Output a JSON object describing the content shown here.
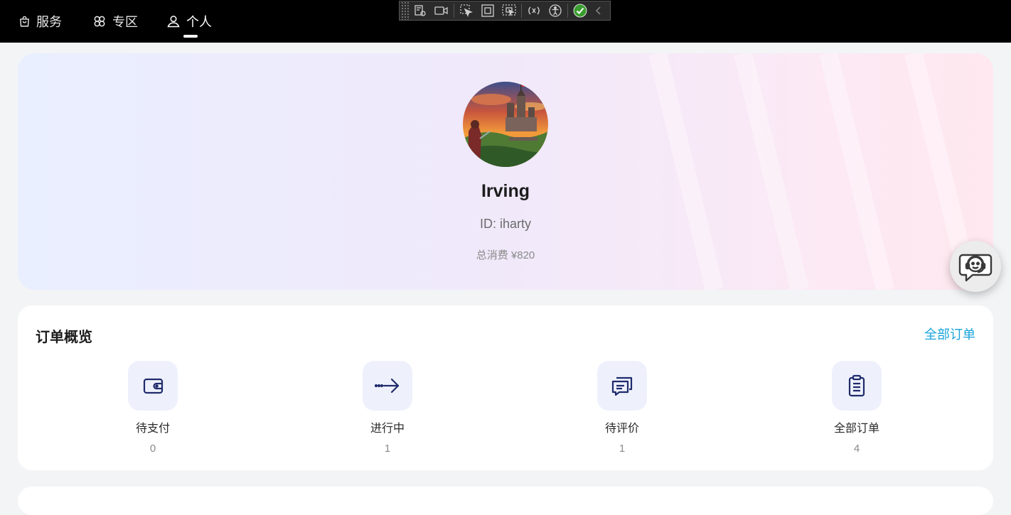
{
  "nav": {
    "tabs": [
      {
        "label": "服务",
        "icon": "shopping-bag-icon"
      },
      {
        "label": "专区",
        "icon": "clover-icon"
      },
      {
        "label": "个人",
        "icon": "user-icon",
        "active": true
      }
    ]
  },
  "profile": {
    "name": "Irving",
    "id_text": "ID: iharty",
    "total_spend": "总消费 ¥820",
    "avatar": "castle-knight-avatar"
  },
  "orders": {
    "title": "订单概览",
    "view_all": "全部订单",
    "items": [
      {
        "label": "待支付",
        "count": "0",
        "icon": "wallet-icon"
      },
      {
        "label": "进行中",
        "count": "1",
        "icon": "arrow-right-icon"
      },
      {
        "label": "待评价",
        "count": "1",
        "icon": "chat-icon"
      },
      {
        "label": "全部订单",
        "count": "4",
        "icon": "clipboard-list-icon"
      }
    ]
  },
  "support": {
    "icon": "customer-service-icon"
  },
  "colors": {
    "topbar": "#000000",
    "accent_link": "#1aa3d9",
    "icon_navy": "#1f2b6b",
    "icon_bg": "#eef1fc"
  }
}
